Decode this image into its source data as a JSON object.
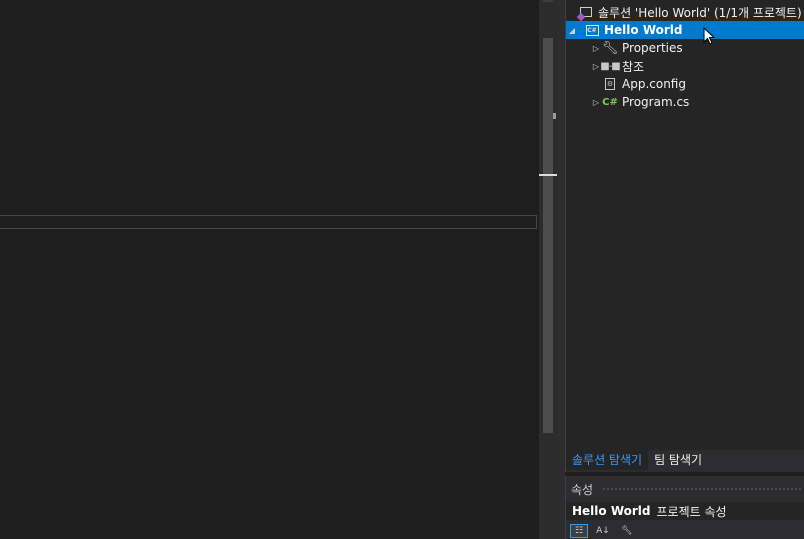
{
  "solution_explorer": {
    "root_label": "솔루션 'Hello World' (1/1개 프로젝트)",
    "items": [
      {
        "label": "Hello World",
        "icon": "csharp-project-icon",
        "selected": true,
        "expanded": true
      },
      {
        "label": "Properties",
        "icon": "wrench-icon",
        "expanded": false
      },
      {
        "label": "참조",
        "icon": "references-icon",
        "expanded": false
      },
      {
        "label": "App.config",
        "icon": "config-file-icon"
      },
      {
        "label": "Program.cs",
        "icon": "csharp-file-icon",
        "expanded": false
      }
    ],
    "tabs": [
      {
        "label": "솔루션 탐색기",
        "active": true
      },
      {
        "label": "팀 탐색기",
        "active": false
      }
    ]
  },
  "properties": {
    "title": "속성",
    "object_name": "Hello World",
    "object_type": "프로젝트 속성",
    "toolbar": [
      "categorized-icon",
      "alphabetical-icon",
      "property-pages-icon"
    ]
  },
  "colors": {
    "selection": "#007acc",
    "accent": "#3399ff",
    "editor_bg": "#1e1e1e",
    "panel_bg": "#252526"
  }
}
